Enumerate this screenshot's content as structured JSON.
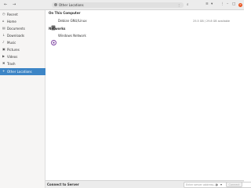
{
  "header": {
    "back_icon": "←",
    "forward_icon": "→",
    "location": "Other Locations",
    "search_icon": "⌕",
    "menu_icon": "⋮",
    "close_icon": "✕"
  },
  "sidebar": {
    "items": [
      {
        "label": "Recent",
        "icon": "◷"
      },
      {
        "label": "Home",
        "icon": "⌂"
      },
      {
        "label": "Documents",
        "icon": "▤"
      },
      {
        "label": "Downloads",
        "icon": "↓"
      },
      {
        "label": "Music",
        "icon": "♪"
      },
      {
        "label": "Pictures",
        "icon": "▣"
      },
      {
        "label": "Videos",
        "icon": "▶"
      },
      {
        "label": "Trash",
        "icon": "✖"
      },
      {
        "label": "Other Locations",
        "icon": "+"
      }
    ]
  },
  "main": {
    "section_computer": "On This Computer",
    "computer_item": {
      "label": "Debian GNU/Linux",
      "info": "25.5 GB / 29.8 GB available"
    },
    "section_networks": "Networks",
    "network_item": {
      "label": "Windows Network"
    }
  },
  "footer": {
    "label": "Connect to Server",
    "placeholder": "Enter server address…",
    "connect_label": "Connect"
  },
  "colors": {
    "accent": "#3d85c6",
    "close": "#e95420"
  }
}
